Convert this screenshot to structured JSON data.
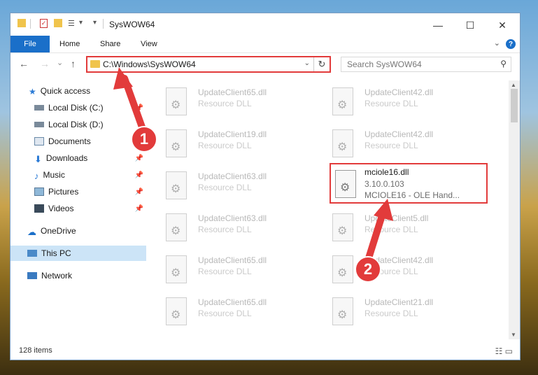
{
  "window": {
    "title": "SysWOW64",
    "min_glyph": "—",
    "max_glyph": "☐",
    "close_glyph": "✕",
    "dropdown_glyph": "▾"
  },
  "ribbon": {
    "tabs": [
      "File",
      "Home",
      "Share",
      "View"
    ],
    "collapse_glyph": "⌄",
    "help_glyph": "?"
  },
  "nav": {
    "back_glyph": "←",
    "forward_glyph": "→",
    "recent_glyph": "⌄",
    "up_glyph": "↑",
    "address": "C:\\Windows\\SysWOW64",
    "address_dropdown_glyph": "⌄",
    "refresh_glyph": "↻",
    "search_placeholder": "Search SysWOW64",
    "search_glyph": "⚲"
  },
  "sidebar": {
    "pin_glyph": "📌",
    "items": [
      {
        "label": "Quick access",
        "icon": "star-icon"
      },
      {
        "label": "Local Disk (C:)",
        "icon": "drive-icon"
      },
      {
        "label": "Local Disk (D:)",
        "icon": "drive-icon"
      },
      {
        "label": "Documents",
        "icon": "documents-icon"
      },
      {
        "label": "Downloads",
        "icon": "download-icon"
      },
      {
        "label": "Music",
        "icon": "music-icon"
      },
      {
        "label": "Pictures",
        "icon": "pictures-icon"
      },
      {
        "label": "Videos",
        "icon": "videos-icon"
      },
      {
        "label": "OneDrive",
        "icon": "cloud-icon"
      },
      {
        "label": "This PC",
        "icon": "computer-icon"
      },
      {
        "label": "Network",
        "icon": "network-icon"
      }
    ]
  },
  "files": [
    {
      "name": "UpdateClient65.dll",
      "type": "Resource DLL"
    },
    {
      "name": "UpdateClient42.dll",
      "type": "Resource DLL"
    },
    {
      "name": "UpdateClient19.dll",
      "type": "Resource DLL"
    },
    {
      "name": "UpdateClient42.dll",
      "type": "Resource DLL"
    },
    {
      "name": "UpdateClient63.dll",
      "type": "Resource DLL"
    },
    {
      "name": "UpdateClient63.dll",
      "type": "Resource DLL"
    },
    {
      "name": "UpdateClient5.dll",
      "type": "Resource DLL"
    },
    {
      "name": "UpdateClient65.dll",
      "type": "Resource DLL"
    },
    {
      "name": "UpdateClient42.dll",
      "type": "Resource DLL"
    },
    {
      "name": "UpdateClient65.dll",
      "type": "Resource DLL"
    },
    {
      "name": "UpdateClient21.dll",
      "type": "Resource DLL"
    }
  ],
  "highlighted_file": {
    "name": "mciole16.dll",
    "version": "3.10.0.103",
    "description": "MCIOLE16 - OLE Hand..."
  },
  "status": {
    "item_count": "128 items",
    "view_glyphs": "☷ ▭"
  },
  "scroll": {
    "up_glyph": "▲",
    "down_glyph": "▼"
  },
  "annotations": {
    "step1": "1",
    "step2": "2",
    "color": "#e23b3b"
  }
}
